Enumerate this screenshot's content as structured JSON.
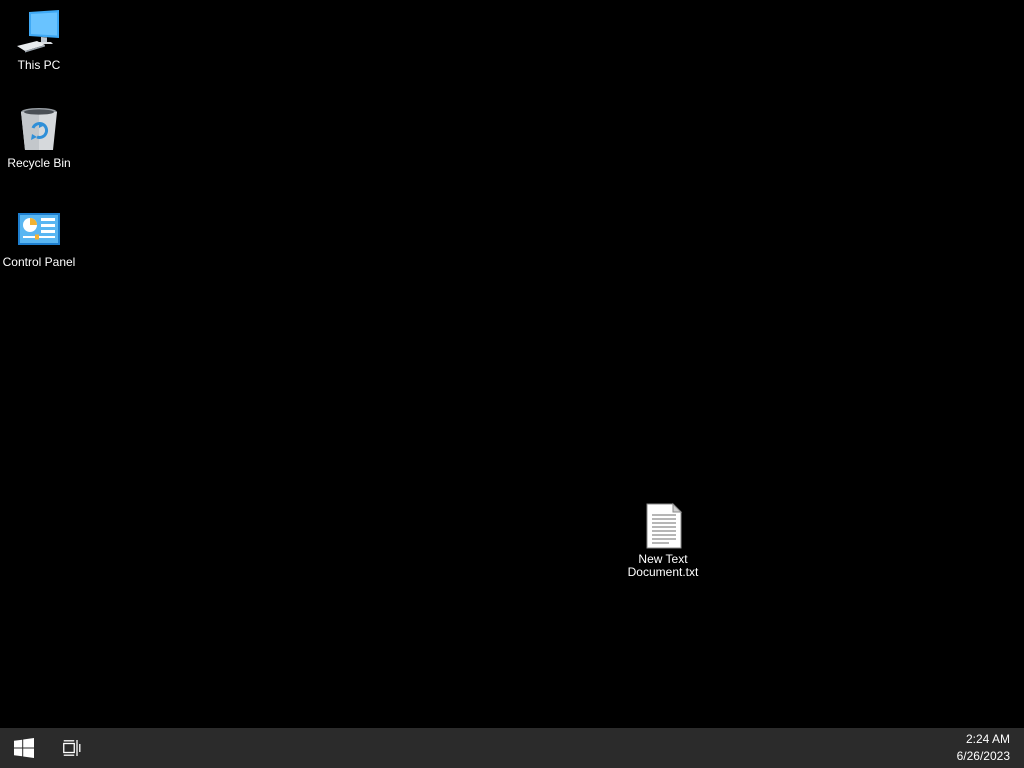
{
  "desktop": {
    "icons": [
      {
        "label": "This PC",
        "icon": "computer-monitor-icon"
      },
      {
        "label": "Recycle Bin",
        "icon": "recycle-bin-icon"
      },
      {
        "label": "Control Panel",
        "icon": "control-panel-icon"
      },
      {
        "label": "New Text\nDocument.txt",
        "icon": "text-document-icon"
      }
    ],
    "background_color": "#000000"
  },
  "taskbar": {
    "start_icon": "windows-logo-icon",
    "task_view_icon": "task-view-icon",
    "clock": {
      "time": "2:24 AM",
      "date": "6/26/2023"
    },
    "background_color": "#2b2b2b"
  }
}
